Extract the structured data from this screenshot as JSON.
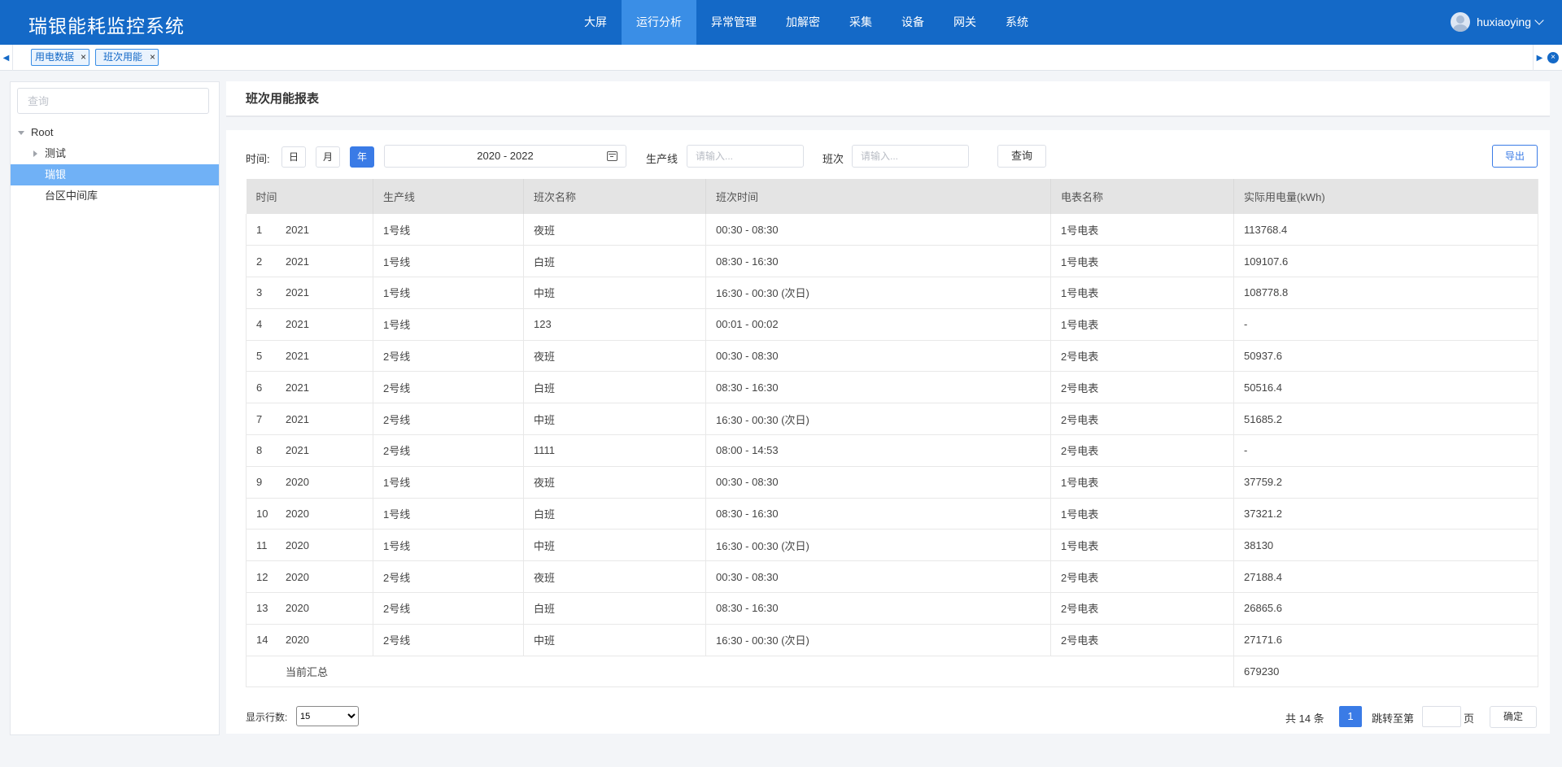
{
  "header": {
    "title": "瑞银能耗监控系统",
    "nav": [
      "大屏",
      "运行分析",
      "异常管理",
      "加解密",
      "采集",
      "设备",
      "网关",
      "系统"
    ],
    "active_nav": "运行分析",
    "username": "huxiaoying"
  },
  "tabs": [
    {
      "label": "用电数据"
    },
    {
      "label": "班次用能"
    }
  ],
  "tree": {
    "search_placeholder": "查询",
    "nodes": [
      {
        "label": "Root",
        "level": 0,
        "expanded": true
      },
      {
        "label": "测试",
        "level": 1,
        "expanded": false
      },
      {
        "label": "瑞银",
        "level": 1,
        "selected": true
      },
      {
        "label": "台区中间库",
        "level": 1
      }
    ]
  },
  "panel": {
    "title": "班次用能报表"
  },
  "filters": {
    "time_label": "时间:",
    "periods": [
      "日",
      "月",
      "年"
    ],
    "active_period": "年",
    "date_range": "2020 - 2022",
    "line_label": "生产线",
    "line_placeholder": "请输入...",
    "shift_label": "班次",
    "shift_placeholder": "请输入...",
    "query_button": "查询",
    "export_button": "导出"
  },
  "table": {
    "columns": [
      "时间",
      "生产线",
      "班次名称",
      "班次时间",
      "电表名称",
      "实际用电量(kWh)"
    ],
    "rows": [
      {
        "idx": "1",
        "year": "2021",
        "line": "1号线",
        "shift": "夜班",
        "time": "00:30 - 08:30",
        "meter": "1号电表",
        "usage": "113768.4"
      },
      {
        "idx": "2",
        "year": "2021",
        "line": "1号线",
        "shift": "白班",
        "time": "08:30 - 16:30",
        "meter": "1号电表",
        "usage": "109107.6"
      },
      {
        "idx": "3",
        "year": "2021",
        "line": "1号线",
        "shift": "中班",
        "time": "16:30 - 00:30 (次日)",
        "meter": "1号电表",
        "usage": "108778.8"
      },
      {
        "idx": "4",
        "year": "2021",
        "line": "1号线",
        "shift": "123",
        "time": "00:01 - 00:02",
        "meter": "1号电表",
        "usage": "-"
      },
      {
        "idx": "5",
        "year": "2021",
        "line": "2号线",
        "shift": "夜班",
        "time": "00:30 - 08:30",
        "meter": "2号电表",
        "usage": "50937.6"
      },
      {
        "idx": "6",
        "year": "2021",
        "line": "2号线",
        "shift": "白班",
        "time": "08:30 - 16:30",
        "meter": "2号电表",
        "usage": "50516.4"
      },
      {
        "idx": "7",
        "year": "2021",
        "line": "2号线",
        "shift": "中班",
        "time": "16:30 - 00:30 (次日)",
        "meter": "2号电表",
        "usage": "51685.2"
      },
      {
        "idx": "8",
        "year": "2021",
        "line": "2号线",
        "shift": "1111",
        "time": "08:00 - 14:53",
        "meter": "2号电表",
        "usage": "-"
      },
      {
        "idx": "9",
        "year": "2020",
        "line": "1号线",
        "shift": "夜班",
        "time": "00:30 - 08:30",
        "meter": "1号电表",
        "usage": "37759.2"
      },
      {
        "idx": "10",
        "year": "2020",
        "line": "1号线",
        "shift": "白班",
        "time": "08:30 - 16:30",
        "meter": "1号电表",
        "usage": "37321.2"
      },
      {
        "idx": "11",
        "year": "2020",
        "line": "1号线",
        "shift": "中班",
        "time": "16:30 - 00:30 (次日)",
        "meter": "1号电表",
        "usage": "38130"
      },
      {
        "idx": "12",
        "year": "2020",
        "line": "2号线",
        "shift": "夜班",
        "time": "00:30 - 08:30",
        "meter": "2号电表",
        "usage": "27188.4"
      },
      {
        "idx": "13",
        "year": "2020",
        "line": "2号线",
        "shift": "白班",
        "time": "08:30 - 16:30",
        "meter": "2号电表",
        "usage": "26865.6"
      },
      {
        "idx": "14",
        "year": "2020",
        "line": "2号线",
        "shift": "中班",
        "time": "16:30 - 00:30 (次日)",
        "meter": "2号电表",
        "usage": "27171.6"
      }
    ],
    "summary_label": "当前汇总",
    "summary_value": "679230"
  },
  "pagination": {
    "rows_label": "显示行数:",
    "rows_options": [
      "15"
    ],
    "rows_selected": "15",
    "total_text": "共 14 条",
    "current_page": "1",
    "jump_label": "跳转至第",
    "page_unit": "页",
    "confirm_button": "确定"
  },
  "colors": {
    "header_bg": "#1469c7",
    "nav_active_bg": "#3a8ee6",
    "primary": "#3a7be6",
    "tree_selected": "#70b1f6"
  }
}
